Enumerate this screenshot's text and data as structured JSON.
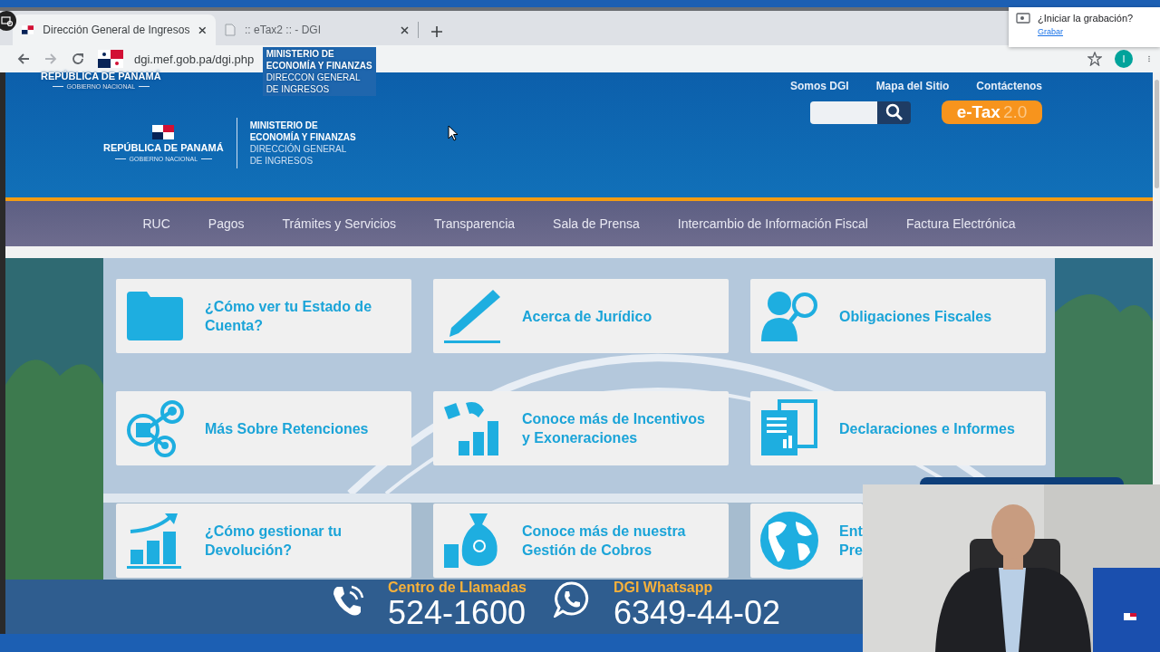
{
  "browser": {
    "tabs": [
      {
        "title": "Dirección General de Ingresos",
        "selected": true
      },
      {
        "title": ":: eTax2 :: - DGI",
        "selected": false
      }
    ],
    "url": "dgi.mef.gob.pa/dgi.php",
    "profile_initial": "I"
  },
  "recording_prompt": {
    "title": "¿Iniciar la grabación?",
    "link": "Grabar"
  },
  "ghost_header": {
    "country": "REPÚBLICA DE PANAMÁ",
    "government": "GOBIERNO NACIONAL",
    "ministry": [
      "MINISTERIO DE",
      "ECONOMÍA Y FINANZAS"
    ],
    "office": [
      "DIRECCON GENERAL",
      "DE INGRESOS"
    ]
  },
  "header": {
    "country": "REPÚBLICA DE PANAMÁ",
    "government": "GOBIERNO NACIONAL",
    "ministry": [
      "MINISTERIO DE",
      "ECONOMÍA Y FINANZAS"
    ],
    "office": [
      "DIRECCIÓN GENERAL",
      "DE INGRESOS"
    ],
    "links": [
      "Somos DGI",
      "Mapa del Sitio",
      "Contáctenos"
    ],
    "etax": {
      "name": "e-Tax",
      "version": "2.0"
    }
  },
  "nav": [
    "RUC",
    "Pagos",
    "Trámites y Servicios",
    "Transparencia",
    "Sala de Prensa",
    "Intercambio de Información Fiscal",
    "Factura Electrónica"
  ],
  "cards": [
    {
      "lines": [
        "¿Cómo ver tu Estado de",
        "Cuenta?"
      ]
    },
    {
      "lines": [
        "Acerca de Jurídico"
      ]
    },
    {
      "lines": [
        "Obligaciones Fiscales"
      ]
    },
    {
      "lines": [
        "Más Sobre Retenciones"
      ]
    },
    {
      "lines": [
        "Conoce más de Incentivos",
        "y Exoneraciones"
      ]
    },
    {
      "lines": [
        "Declaraciones e Informes"
      ]
    },
    {
      "lines": [
        "¿Cómo gestionar tu",
        "Devolución?"
      ]
    },
    {
      "lines": [
        "Conoce más de nuestra",
        "Gestión de Cobros"
      ]
    },
    {
      "lines": [
        "Ent",
        "Pre"
      ]
    }
  ],
  "contact": [
    {
      "label": "Centro de Llamadas",
      "number": "524-1600"
    },
    {
      "label": "DGI Whatsapp",
      "number": "6349-44-02"
    }
  ]
}
